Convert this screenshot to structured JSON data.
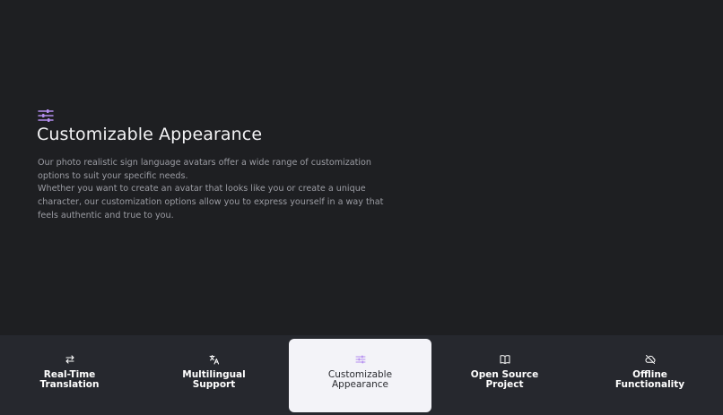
{
  "hero": {
    "icon": "sliders-icon",
    "title": "Customizable Appearance",
    "paragraph1": "Our photo realistic sign language avatars offer a wide range of customization options to suit your specific needs.",
    "paragraph2": "Whether you want to create an avatar that looks like you or create a unique character, our customization options allow you to express yourself in a way that feels authentic and true to you.",
    "accent_color": "#b48ef0"
  },
  "tabs": [
    {
      "line1": "Real-Time",
      "line2": "Translation",
      "icon": "swap-arrows-icon",
      "active": false
    },
    {
      "line1": "Multilingual",
      "line2": "Support",
      "icon": "translate-icon",
      "active": false
    },
    {
      "line1": "Customizable",
      "line2": "Appearance",
      "icon": "sliders-icon",
      "active": true
    },
    {
      "line1": "Open Source",
      "line2": "Project",
      "icon": "book-icon",
      "active": false
    },
    {
      "line1": "Offline",
      "line2": "Functionality",
      "icon": "cloud-off-icon",
      "active": false
    }
  ],
  "colors": {
    "background": "#1e1f22",
    "tabbar": "#26282e",
    "active_tab": "#f3f3f8"
  }
}
